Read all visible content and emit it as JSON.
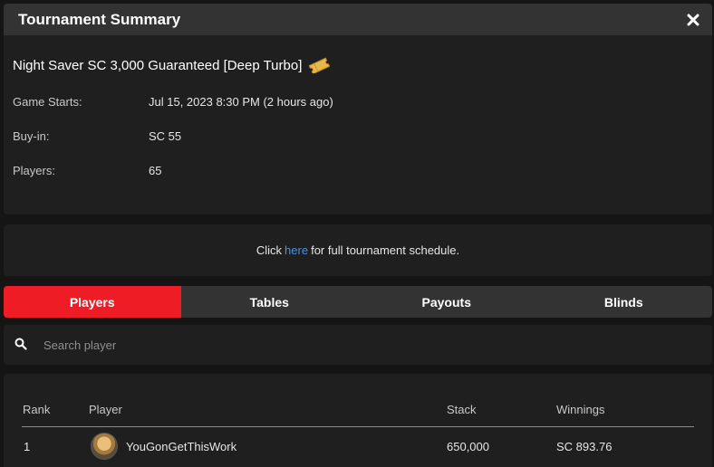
{
  "header": {
    "title": "Tournament Summary",
    "close_icon": "close-icon"
  },
  "tournament": {
    "name": "Night Saver SC 3,000 Guaranteed [Deep Turbo]",
    "ticket_icon": "ticket-icon",
    "ticket_color": "#e8b84a",
    "rows": [
      {
        "label": "Game Starts:",
        "value": "Jul 15, 2023 8:30 PM (2 hours ago)"
      },
      {
        "label": "Buy-in:",
        "value": "SC 55"
      },
      {
        "label": "Players:",
        "value": "65"
      }
    ]
  },
  "schedule": {
    "prefix": "Click",
    "link": "here",
    "suffix": "for full tournament schedule.",
    "link_color": "#4a90e2"
  },
  "tabs": [
    {
      "label": "Players",
      "active": true
    },
    {
      "label": "Tables",
      "active": false
    },
    {
      "label": "Payouts",
      "active": false
    },
    {
      "label": "Blinds",
      "active": false
    }
  ],
  "accent_color": "#ee1c25",
  "search": {
    "placeholder": "Search player",
    "icon": "search-icon"
  },
  "table": {
    "columns": [
      "Rank",
      "Player",
      "Stack",
      "Winnings"
    ],
    "rows": [
      {
        "rank": "1",
        "player": "YouGonGetThisWork",
        "stack": "650,000",
        "winnings": "SC 893.76"
      }
    ]
  }
}
